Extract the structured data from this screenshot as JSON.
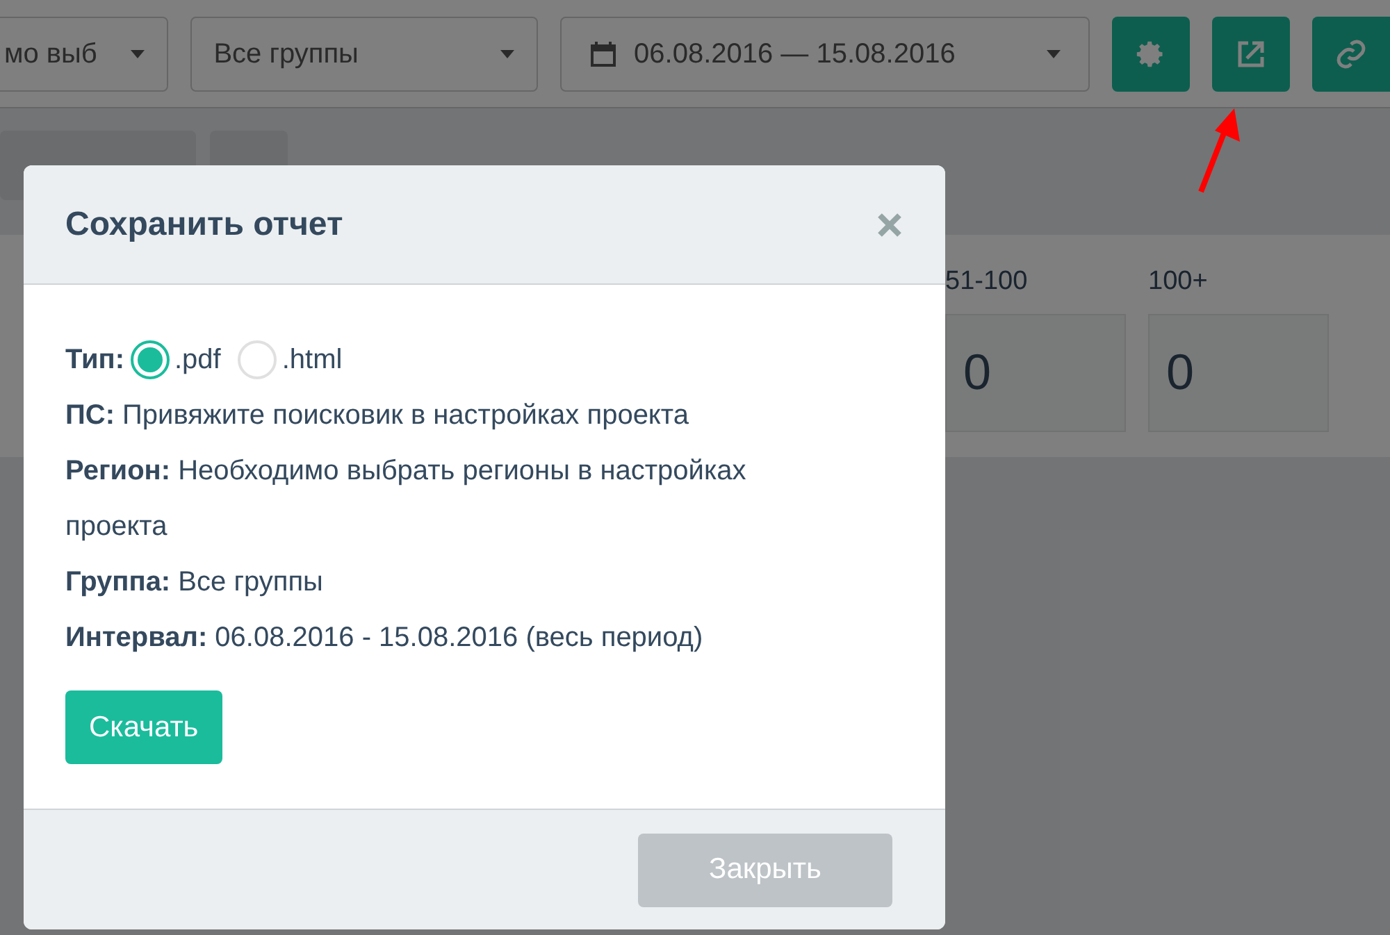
{
  "toolbar": {
    "filter_dropdown": {
      "value": "мо выб"
    },
    "group_dropdown": {
      "value": "Все группы"
    },
    "date_range": {
      "value": "06.08.2016 — 15.08.2016"
    }
  },
  "stats": [
    {
      "label": "51-100",
      "value": "0"
    },
    {
      "label": "100+",
      "value": "0"
    }
  ],
  "dialog": {
    "title": "Сохранить отчет",
    "format_options": [
      {
        "label": ".pdf",
        "selected": true
      },
      {
        "label": ".html",
        "selected": false
      }
    ],
    "type_label": "Тип:",
    "fields": [
      {
        "label": "ПС:",
        "value": "Привяжите поисковик в настройках проекта"
      },
      {
        "label": "Регион:",
        "value": "Необходимо выбрать регионы в настройках проекта"
      },
      {
        "label": "Группа:",
        "value": "Все группы"
      },
      {
        "label": "Интервал:",
        "value": "06.08.2016 - 15.08.2016 (весь период)"
      }
    ],
    "download_button": "Скачать",
    "close_button": "Закрыть"
  }
}
